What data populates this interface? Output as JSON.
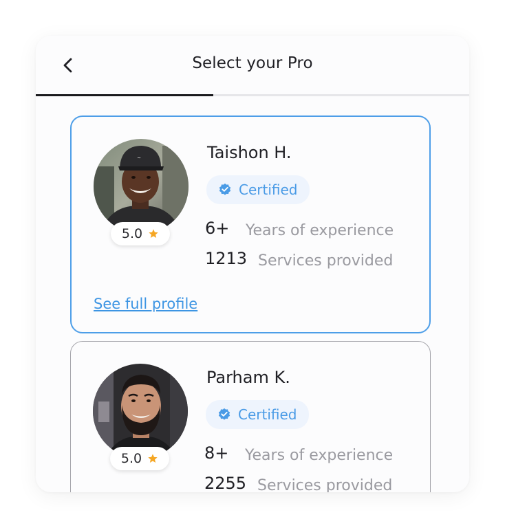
{
  "header": {
    "title": "Select your Pro",
    "back_icon": "chevron-left-icon",
    "progress": 0.41
  },
  "colors": {
    "accent": "#4d9ee8",
    "link": "#3d95e3",
    "star": "#f5a623",
    "certified_bg": "#eef4fd"
  },
  "pros": [
    {
      "name": "Taishon H.",
      "rating": "5.0",
      "certified_label": "Certified",
      "experience_value": "6+",
      "experience_label": "Years of experience",
      "services_value": "1213",
      "services_label": "Services provided",
      "profile_link": "See full profile",
      "selected": true
    },
    {
      "name": "Parham K.",
      "rating": "5.0",
      "certified_label": "Certified",
      "experience_value": "8+",
      "experience_label": "Years of experience",
      "services_value": "2255",
      "services_label": "Services provided",
      "selected": false
    }
  ]
}
